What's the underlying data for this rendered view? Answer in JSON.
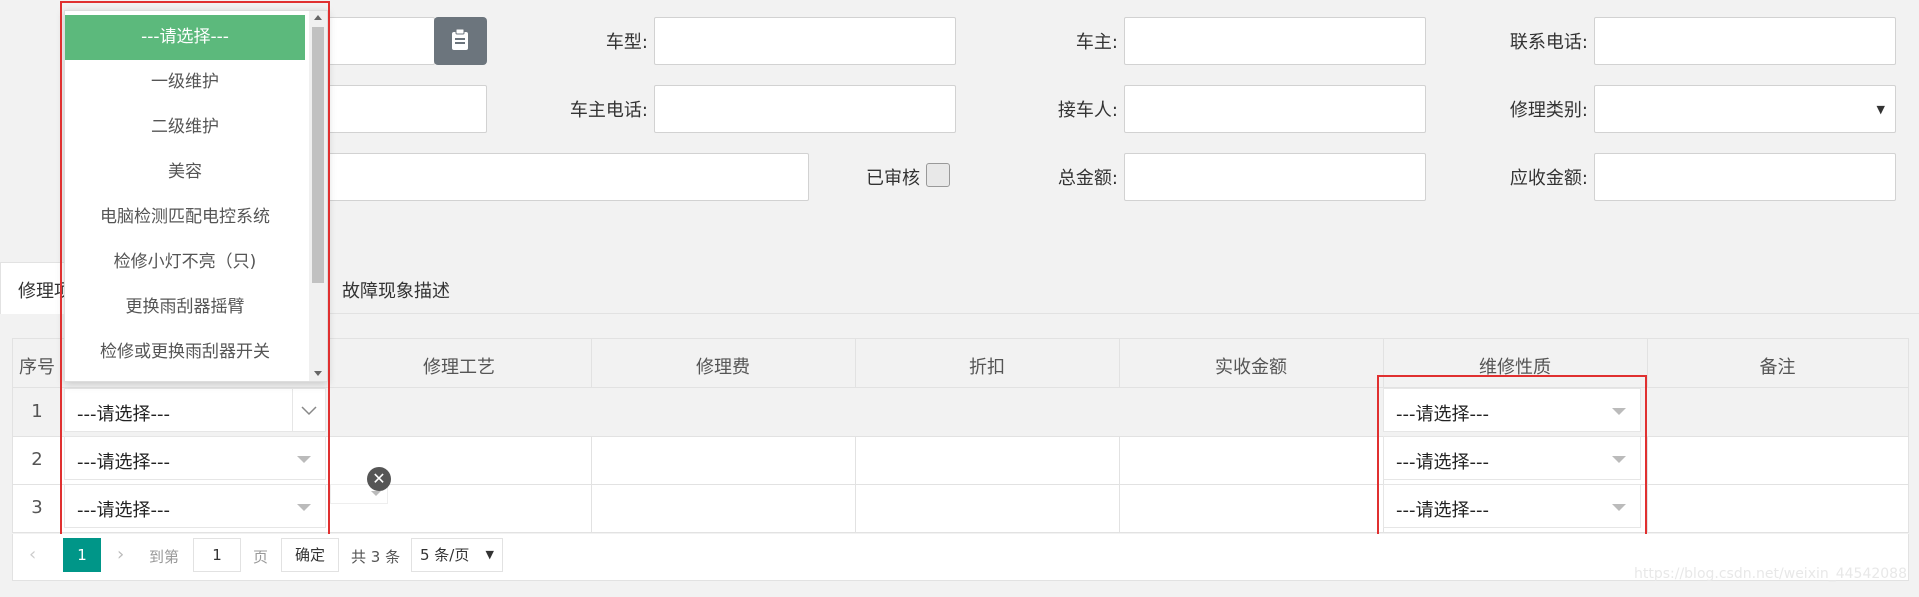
{
  "form": {
    "car_type_label": "车型:",
    "owner_label": "车主:",
    "contact_phone_label": "联系电话:",
    "owner_phone_label": "车主电话:",
    "receiver_label": "接车人:",
    "repair_category_label": "修理类别:",
    "audited_label": "已审核",
    "total_amount_label": "总金额:",
    "receivable_label": "应收金额:"
  },
  "tabs": [
    {
      "label": "修理项"
    },
    {
      "label": "故障现象描述"
    }
  ],
  "dropdown": {
    "items": [
      {
        "label": "---请选择---",
        "selected": true
      },
      {
        "label": "一级维护"
      },
      {
        "label": "二级维护"
      },
      {
        "label": "美容"
      },
      {
        "label": "电脑检测匹配电控系统"
      },
      {
        "label": "检修小灯不亮（只)"
      },
      {
        "label": "更换雨刮器摇臂"
      },
      {
        "label": "检修或更换雨刮器开关"
      }
    ]
  },
  "table": {
    "headers": [
      "序号",
      "修理工艺",
      "修理费",
      "折扣",
      "实收金额",
      "维修性质",
      "备注"
    ],
    "rows": [
      {
        "index": "1",
        "item": "---请选择---",
        "nature": "---请选择---"
      },
      {
        "index": "2",
        "item": "---请选择---",
        "nature": "---请选择---"
      },
      {
        "index": "3",
        "item": "---请选择---",
        "nature": "---请选择---"
      }
    ]
  },
  "pager": {
    "current_page": "1",
    "goto_label": "到第",
    "page_input": "1",
    "page_unit": "页",
    "confirm": "确定",
    "total": "共 3 条",
    "page_size": "5 条/页"
  },
  "watermark": "https://blog.csdn.net/weixin_44542088",
  "colors": {
    "selected_green": "#5cb97c",
    "pager_teal": "#009688",
    "highlight_red": "#e03030"
  }
}
